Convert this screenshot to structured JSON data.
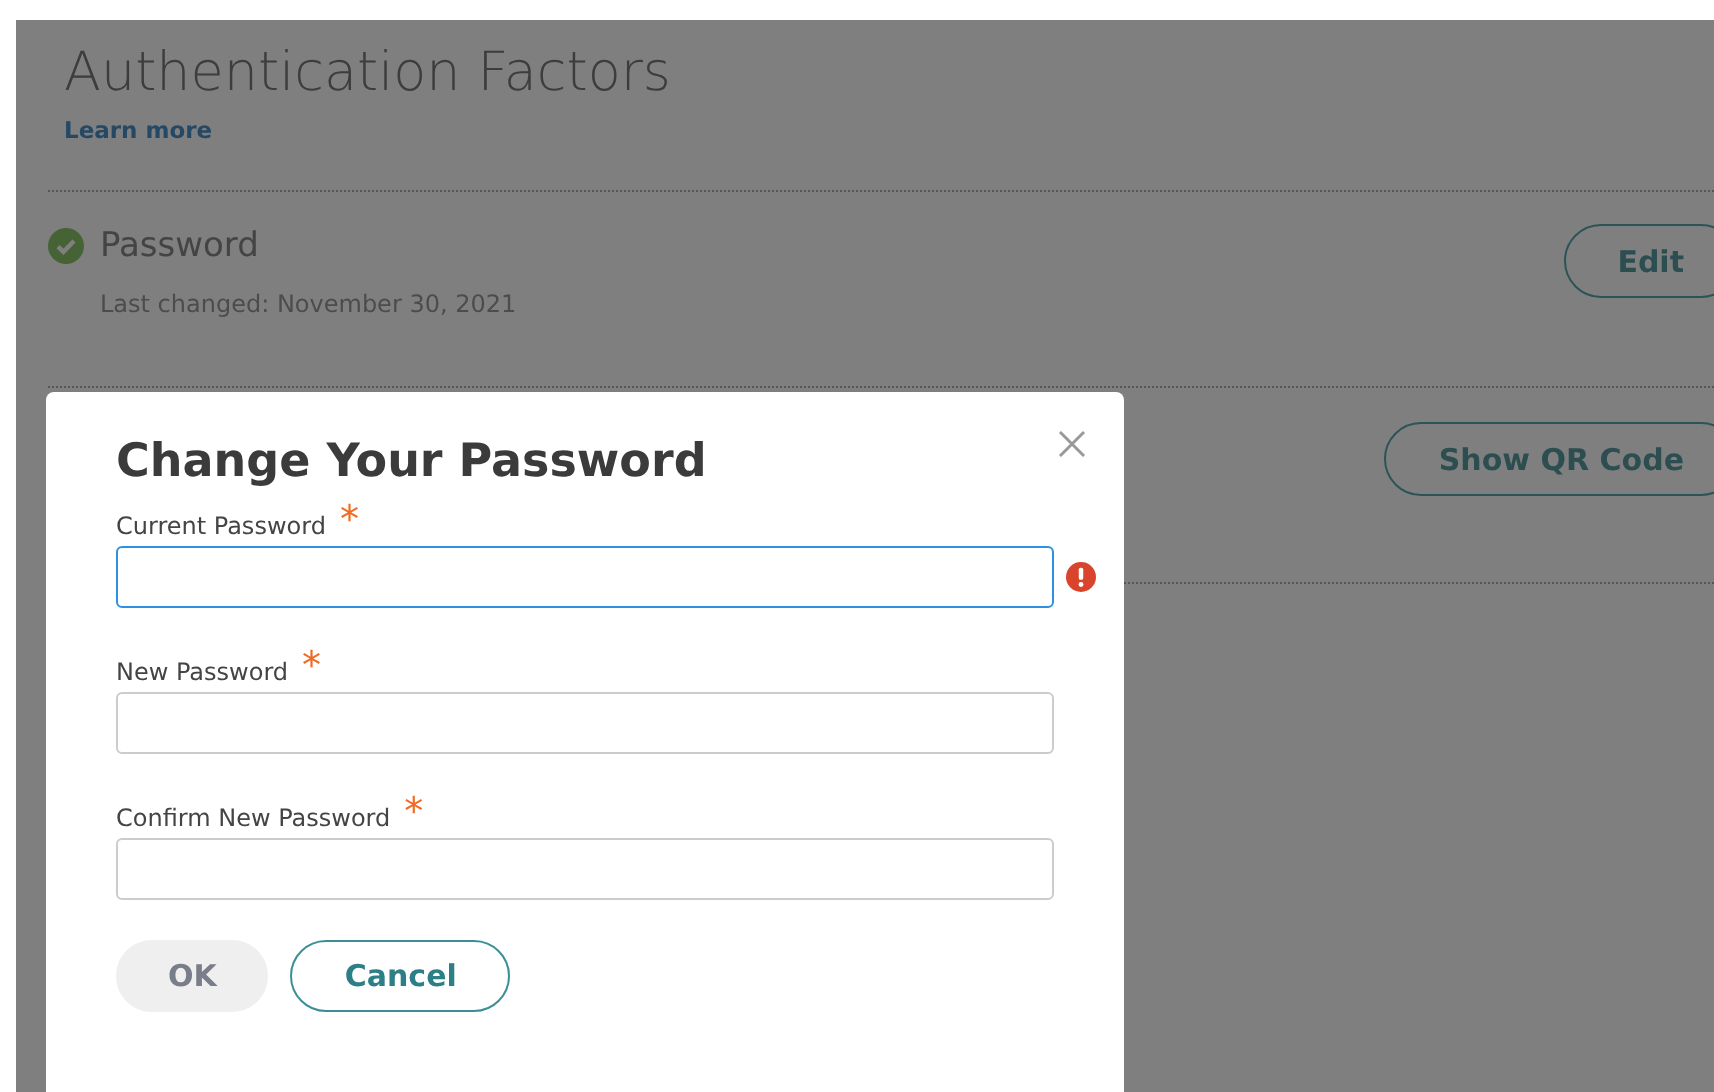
{
  "page": {
    "title": "Authentication Factors",
    "learn_more": "Learn more",
    "factors": [
      {
        "name": "Password",
        "verified": true,
        "detail": "Last changed: November 30, 2021",
        "button": "Edit"
      },
      {
        "button": "Show QR Code"
      }
    ]
  },
  "dialog": {
    "title": "Change Your Password",
    "required_mark": "*",
    "fields": [
      {
        "label": "Current Password",
        "required": true,
        "focused": true,
        "error": true
      },
      {
        "label": "New Password",
        "required": true,
        "focused": false,
        "error": false
      },
      {
        "label": "Confirm New Password",
        "required": true,
        "focused": false,
        "error": false
      }
    ],
    "buttons": [
      {
        "label": "OK",
        "kind": "primary",
        "disabled": true
      },
      {
        "label": "Cancel",
        "kind": "secondary",
        "disabled": false
      }
    ]
  }
}
